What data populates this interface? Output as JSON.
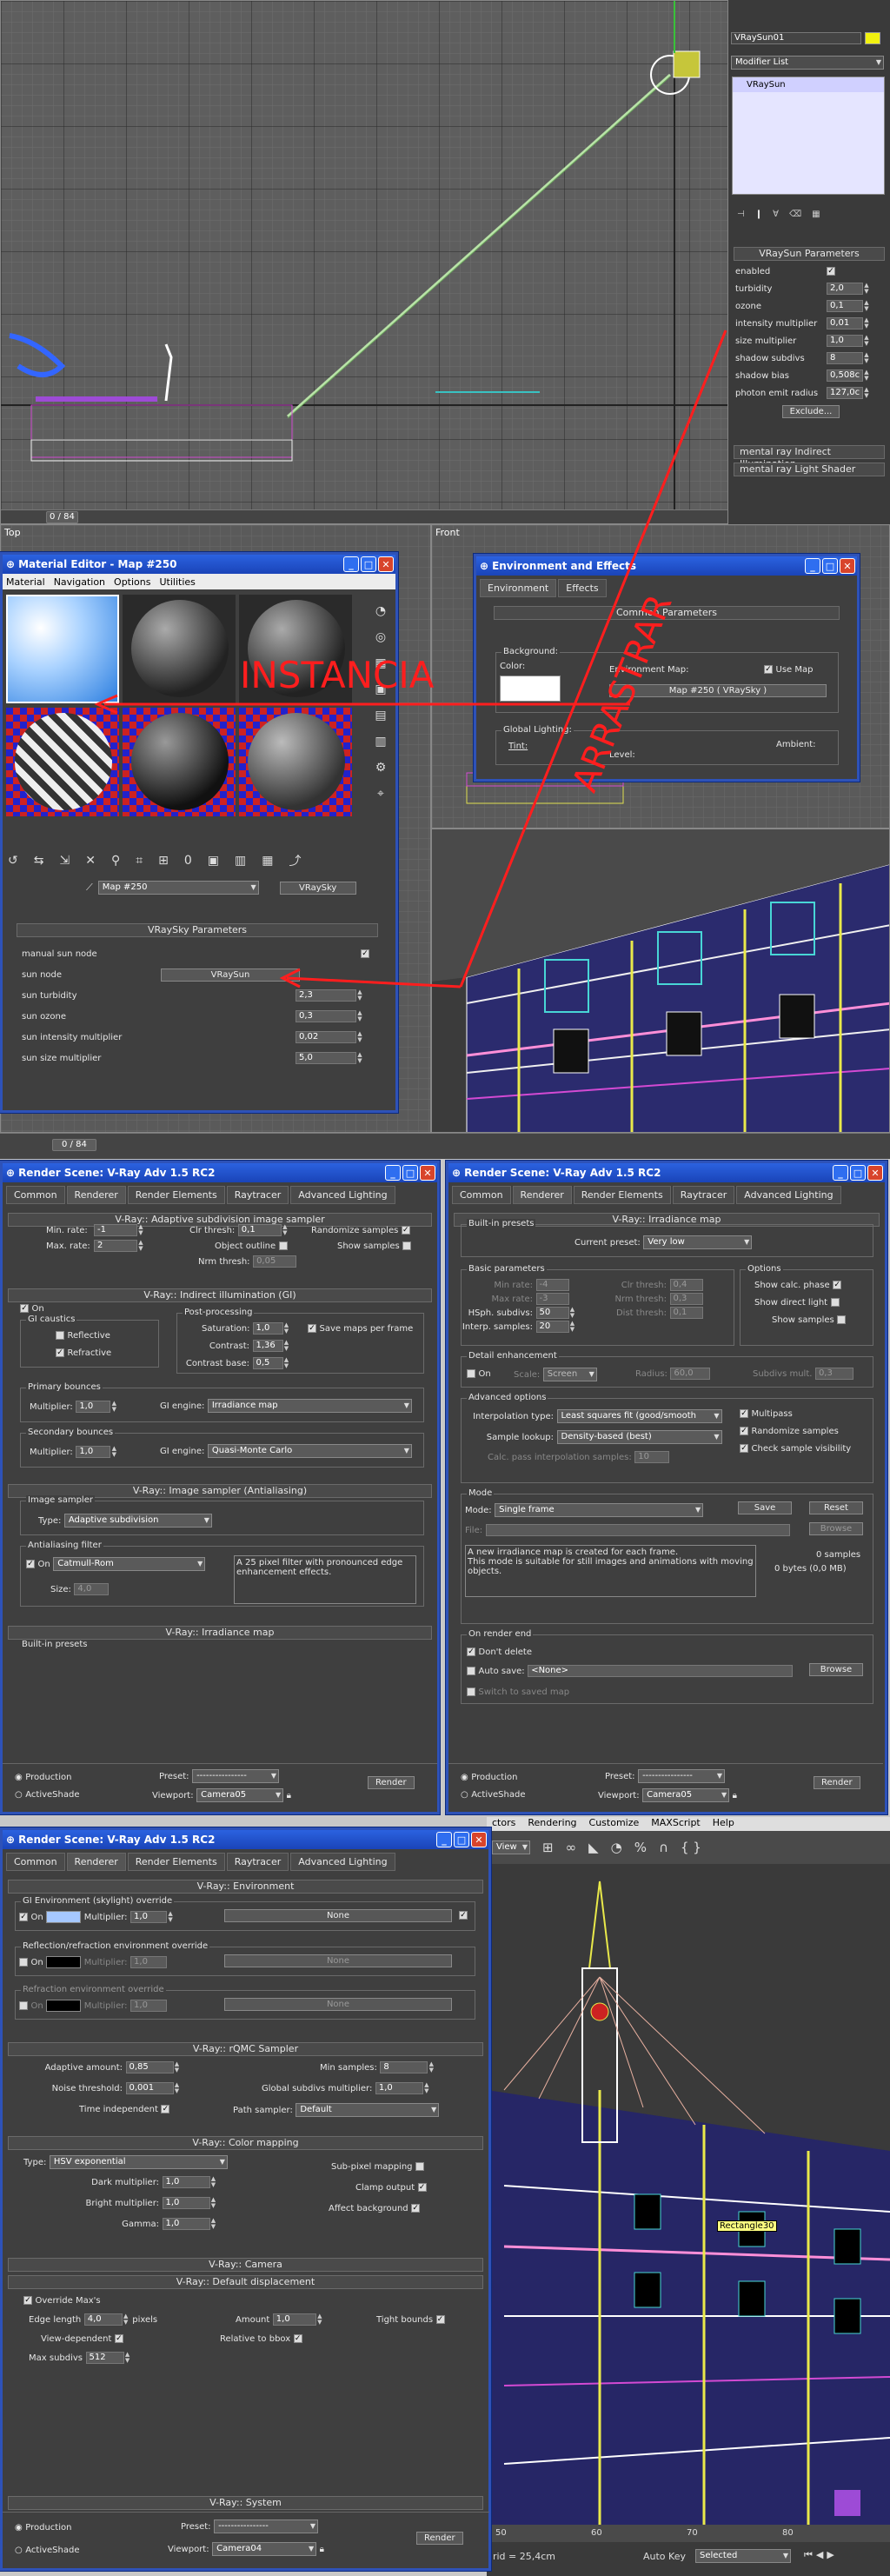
{
  "top_viewport": {
    "frame": "0 / 84"
  },
  "modifier_panel": {
    "object_name": "VRaySun01",
    "modifier_list": "Modifier List",
    "stack_item": "VRaySun",
    "params_title": "VRaySun Parameters",
    "params": [
      {
        "label": "enabled",
        "value": "✓"
      },
      {
        "label": "turbidity",
        "value": "2,0"
      },
      {
        "label": "ozone",
        "value": "0,1"
      },
      {
        "label": "intensity multiplier",
        "value": "0,01"
      },
      {
        "label": "size multiplier",
        "value": "1,0"
      },
      {
        "label": "shadow subdivs",
        "value": "8"
      },
      {
        "label": "shadow bias",
        "value": "0,508c"
      },
      {
        "label": "photon emit radius",
        "value": "127,0c"
      }
    ],
    "exclude_label": "Exclude...",
    "rollout_1": "mental ray Indirect Illumination",
    "rollout_2": "mental ray Light Shader"
  },
  "viewport_labels": {
    "top": "Top",
    "front": "Front",
    "frame2": "0 / 84"
  },
  "material_editor": {
    "title": "Material Editor - Map #250",
    "menu": [
      "Material",
      "Navigation",
      "Options",
      "Utilities"
    ],
    "map_name": "Map #250",
    "map_type": "VRaySky",
    "rollout": "VRaySky Parameters",
    "params": [
      {
        "label": "manual sun node",
        "value": "✓"
      },
      {
        "label": "sun node",
        "value": "VRaySun"
      },
      {
        "label": "sun turbidity",
        "value": "2,3"
      },
      {
        "label": "sun ozone",
        "value": "0,3"
      },
      {
        "label": "sun intensity multiplier",
        "value": "0,02"
      },
      {
        "label": "sun size multiplier",
        "value": "5,0"
      }
    ]
  },
  "environment": {
    "title": "Environment and Effects",
    "tabs": [
      "Environment",
      "Effects"
    ],
    "rollout": "Common Parameters",
    "background": "Background:",
    "color": "Color:",
    "env_map": "Environment Map:",
    "use_map": "Use Map",
    "map_button": "Map #250  ( VRaySky )",
    "global_lighting": "Global Lighting:",
    "tint": "Tint:",
    "level": "Level:",
    "ambient": "Ambient:"
  },
  "annotations": {
    "instancia": "INSTANCIA",
    "arrastrar": "ARRASTRAR"
  },
  "render_left": {
    "title": "Render Scene: V-Ray Adv 1.5 RC2",
    "tabs": [
      "Common",
      "Renderer",
      "Render Elements",
      "Raytracer",
      "Advanced Lighting"
    ],
    "r1": "V-Ray:: Adaptive subdivision image sampler",
    "min_rate_l": "Min. rate:",
    "min_rate": "-1",
    "max_rate_l": "Max. rate:",
    "max_rate": "2",
    "clr_thresh_l": "Clr thresh:",
    "clr_thresh": "0,1",
    "obj_outline": "Object outline",
    "nrm_thresh_l": "Nrm thresh:",
    "nrm_thresh": "0,05",
    "randomize": "Randomize samples",
    "show_samples": "Show samples",
    "r2": "V-Ray:: Indirect illumination (GI)",
    "on": "On",
    "gi_caustics": "GI caustics",
    "reflective": "Reflective",
    "refractive": "Refractive",
    "post": "Post-processing",
    "saturation_l": "Saturation:",
    "saturation": "1,0",
    "contrast_l": "Contrast:",
    "contrast": "1,36",
    "contrast_base_l": "Contrast base:",
    "contrast_base": "0,5",
    "save_maps": "Save maps per frame",
    "primary": "Primary bounces",
    "multiplier": "Multiplier:",
    "prim_mult": "1,0",
    "gi_engine": "GI engine:",
    "prim_engine": "Irradiance map",
    "secondary": "Secondary bounces",
    "sec_mult": "1,0",
    "sec_engine": "Quasi-Monte Carlo",
    "r3": "V-Ray:: Image sampler (Antialiasing)",
    "image_sampler": "Image sampler",
    "type_l": "Type:",
    "type": "Adaptive subdivision",
    "aa_filter": "Antialiasing filter",
    "filter": "Catmull-Rom",
    "size_l": "Size:",
    "size": "4,0",
    "filter_desc": "A 25 pixel filter with pronounced edge enhancement effects.",
    "r4": "V-Ray:: Irradiance map",
    "builtin": "Built-in presets",
    "production": "Production",
    "activeshade": "ActiveShade",
    "preset_l": "Preset:",
    "preset": "----------------",
    "viewport_l": "Viewport:",
    "viewport": "Camera05",
    "render": "Render"
  },
  "render_right": {
    "title": "Render Scene: V-Ray Adv 1.5 RC2",
    "tabs": [
      "Common",
      "Renderer",
      "Render Elements",
      "Raytracer",
      "Advanced Lighting"
    ],
    "r1": "V-Ray:: Irradiance map",
    "builtin": "Built-in presets",
    "current_preset_l": "Current preset:",
    "current_preset": "Very low",
    "basic": "Basic parameters",
    "min_rate_l": "Min rate:",
    "min_rate": "-4",
    "max_rate_l": "Max rate:",
    "max_rate": "-3",
    "hsph_l": "HSph. subdivs:",
    "hsph": "50",
    "interp_l": "Interp. samples:",
    "interp": "20",
    "clr_l": "Clr thresh:",
    "clr": "0,4",
    "nrm_l": "Nrm thresh:",
    "nrm": "0,3",
    "dist_l": "Dist thresh:",
    "dist": "0,1",
    "options": "Options",
    "show_calc": "Show calc. phase",
    "show_direct": "Show direct light",
    "show_samples": "Show samples",
    "detail": "Detail enhancement",
    "on": "On",
    "scale_l": "Scale:",
    "scale": "Screen",
    "radius_l": "Radius:",
    "radius": "60,0",
    "subdivs_l": "Subdivs mult.",
    "subdivs": "0,3",
    "adv": "Advanced options",
    "interp_type_l": "Interpolation type:",
    "interp_type": "Least squares fit (good/smooth",
    "sample_lookup_l": "Sample lookup:",
    "sample_lookup": "Density-based (best)",
    "calc_pass_l": "Calc. pass interpolation samples:",
    "calc_pass": "10",
    "multipass": "Multipass",
    "randomize": "Randomize samples",
    "check_vis": "Check sample visibility",
    "mode": "Mode",
    "mode_l": "Mode:",
    "mode_v": "Single frame",
    "save": "Save",
    "reset": "Reset",
    "file_l": "File:",
    "browse": "Browse",
    "desc": "A new irradiance map is created for each frame.\nThis mode is suitable for still images and animations with moving objects.",
    "samples": "0 samples",
    "bytes": "0 bytes (0,0 MB)",
    "on_end": "On render end",
    "dont_delete": "Don't delete",
    "auto_save": "Auto save:",
    "none": "<None>",
    "switch_saved": "Switch to saved map",
    "production": "Production",
    "activeshade": "ActiveShade",
    "preset_l": "Preset:",
    "preset": "----------------",
    "viewport_l": "Viewport:",
    "viewport": "Camera05",
    "render": "Render"
  },
  "render_bottom": {
    "title": "Render Scene: V-Ray Adv 1.5 RC2",
    "tabs": [
      "Common",
      "Renderer",
      "Render Elements",
      "Raytracer",
      "Advanced Lighting"
    ],
    "r1": "V-Ray:: Environment",
    "gi_env": "GI Environment (skylight) override",
    "on": "On",
    "multiplier": "Multiplier:",
    "gi_mult": "1,0",
    "none": "None",
    "refl_env": "Reflection/refraction environment override",
    "refl_mult": "1,0",
    "refr_env": "Refraction environment override",
    "refr_mult": "1,0",
    "r2": "V-Ray:: rQMC Sampler",
    "adaptive_l": "Adaptive amount:",
    "adaptive": "0,85",
    "noise_l": "Noise threshold:",
    "noise": "0,001",
    "time_indep": "Time independent",
    "min_samples_l": "Min samples:",
    "min_samples": "8",
    "global_l": "Global subdivs multiplier:",
    "global": "1,0",
    "path_l": "Path sampler:",
    "path": "Default",
    "r3": "V-Ray:: Color mapping",
    "type_l": "Type:",
    "type": "HSV exponential",
    "dark_l": "Dark multiplier:",
    "dark": "1,0",
    "bright_l": "Bright multiplier:",
    "bright": "1,0",
    "gamma_l": "Gamma:",
    "gamma": "1,0",
    "subpixel": "Sub-pixel mapping",
    "clamp": "Clamp output",
    "affect_bg": "Affect background",
    "r4": "V-Ray:: Camera",
    "r5": "V-Ray:: Default displacement",
    "override": "Override Max's",
    "edge_l": "Edge length",
    "edge": "4,0",
    "pixels": "pixels",
    "view_dep": "View-dependent",
    "max_subdivs_l": "Max subdivs",
    "max_subdivs": "512",
    "amount_l": "Amount",
    "amount": "1,0",
    "rel_bbox": "Relative to bbox",
    "tight": "Tight bounds",
    "r6": "V-Ray:: System",
    "production": "Production",
    "activeshade": "ActiveShade",
    "preset_l": "Preset:",
    "preset": "----------------",
    "viewport_l": "Viewport:",
    "viewport": "Camera04",
    "render": "Render"
  },
  "bottom_right": {
    "menu": [
      "ctors",
      "Rendering",
      "Customize",
      "MAXScript",
      "Help"
    ],
    "view": "View",
    "tag": "Rectangle30",
    "ruler": [
      "50",
      "60",
      "70",
      "80"
    ],
    "grid": "grid = 25,4cm",
    "autokey": "Auto Key",
    "selected": "Selected"
  }
}
